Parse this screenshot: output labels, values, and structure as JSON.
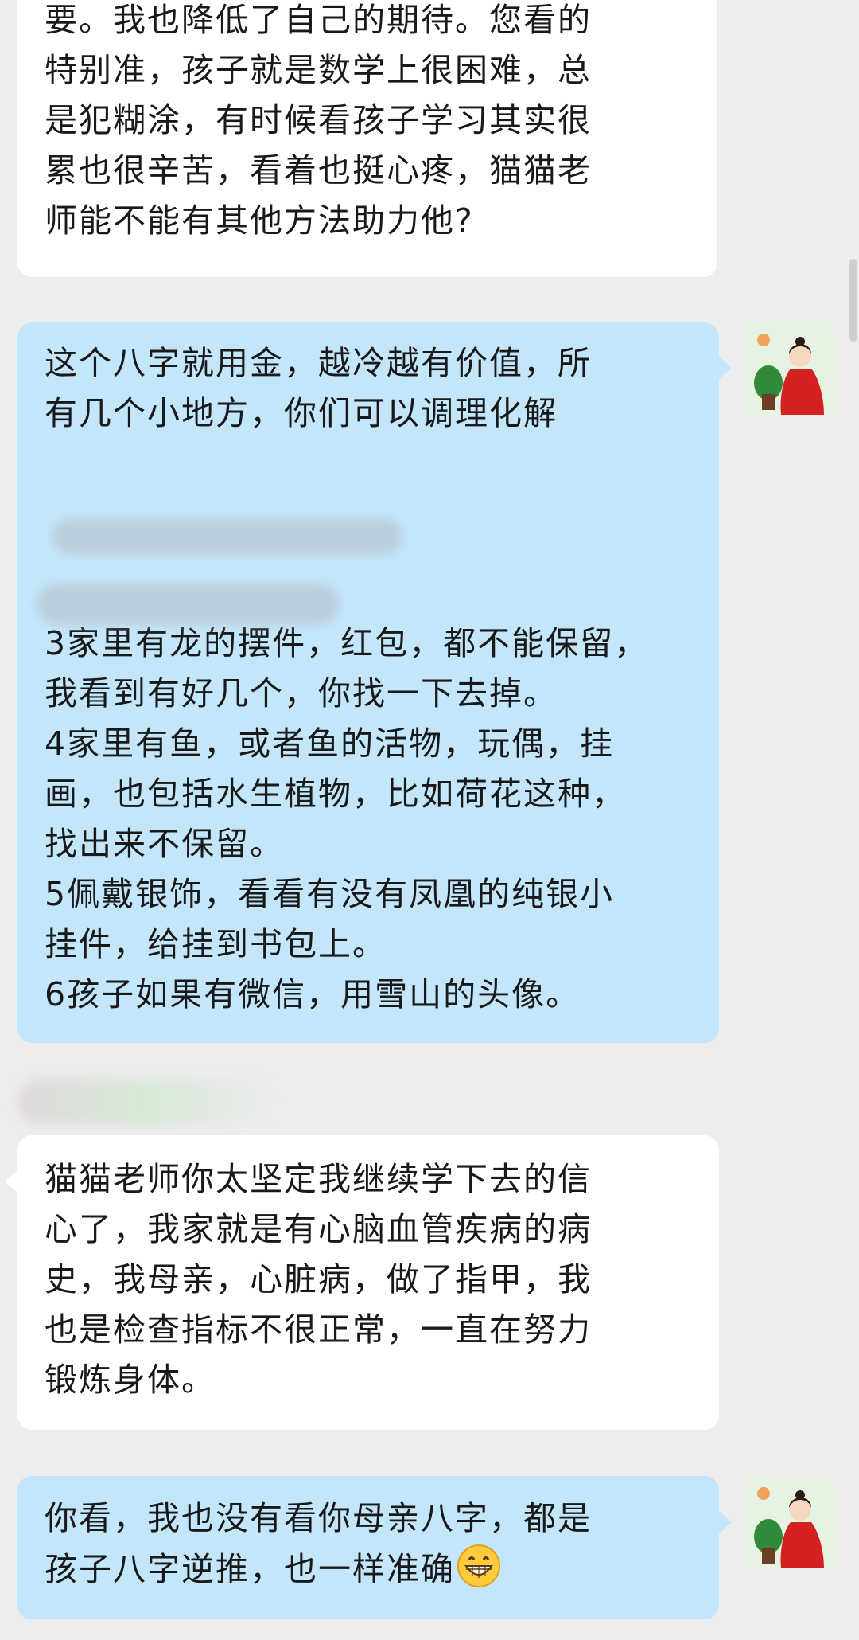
{
  "messages": [
    {
      "id": "msg1",
      "side": "left",
      "lines": [
        "要。我也降低了自己的期待。您看的",
        "特别准，孩子就是数学上很困难，总",
        "是犯糊涂，有时候看孩子学习其实很",
        "累也很辛苦，看着也挺心疼，猫猫老",
        "师能不能有其他方法助力他?"
      ]
    },
    {
      "id": "msg2",
      "side": "right",
      "lines_top": [
        "这个八字就用金，越冷越有价值，所",
        "有几个小地方，你们可以调理化解"
      ],
      "lines_bottom": [
        "3家里有龙的摆件，红包，都不能保留，",
        "我看到有好几个，你找一下去掉。",
        "4家里有鱼，或者鱼的活物，玩偶，挂",
        "画，也包括水生植物，比如荷花这种，",
        "找出来不保留。",
        "5佩戴银饰，看看有没有凤凰的纯银小",
        "挂件，给挂到书包上。",
        "6孩子如果有微信，用雪山的头像。"
      ]
    },
    {
      "id": "msg3",
      "side": "left",
      "lines": [
        "猫猫老师你太坚定我继续学下去的信",
        "心了，我家就是有心脑血管疾病的病",
        "史，我母亲，心脏病，做了指甲，我",
        "也是检查指标不很正常，一直在努力",
        "锻炼身体。"
      ]
    },
    {
      "id": "msg4",
      "side": "right",
      "lines": [
        "你看，我也没有看你母亲八字，都是",
        "孩子八字逆推，也一样准确"
      ],
      "emoji": "grinning-face"
    }
  ],
  "colors": {
    "background": "#ededed",
    "incoming_bubble": "#ffffff",
    "outgoing_bubble": "#c4e6fb",
    "text": "#191919"
  },
  "avatar": {
    "icon": "teacher-avatar-icon"
  }
}
